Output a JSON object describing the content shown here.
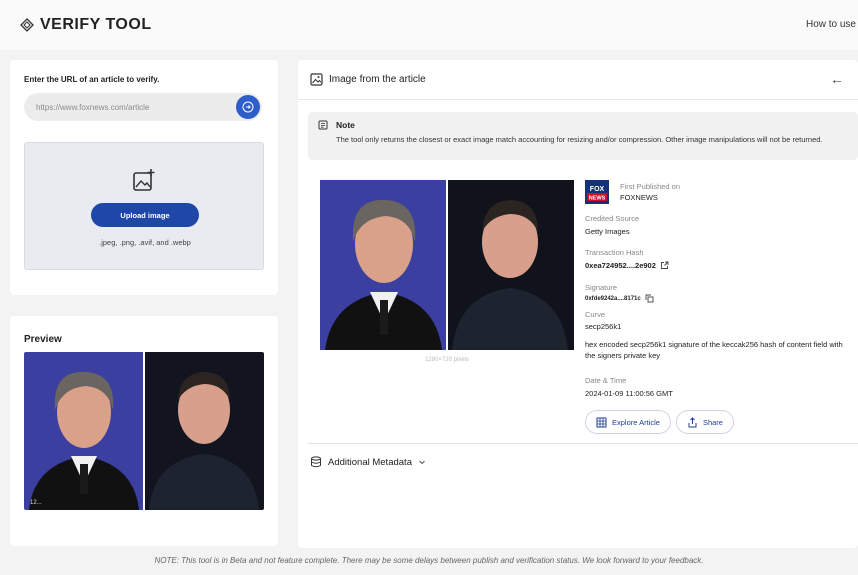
{
  "header": {
    "title": "VERIFY TOOL",
    "how_to_use": "How to use"
  },
  "url_form": {
    "label": "Enter the URL of an article to verify.",
    "placeholder": "https://www.foxnews.com/article"
  },
  "upload": {
    "button_label": "Upload image",
    "formats": ".jpeg, .png, .avif, and .webp"
  },
  "preview": {
    "title": "Preview",
    "caption": "12..."
  },
  "panel": {
    "title": "Image from the article",
    "note_title": "Note",
    "note_text": "The tool only returns the closest or exact image match accounting for resizing and/or compression. Other image manipulations will not be returned.",
    "image_caption": "1280×720 pixels"
  },
  "metadata": {
    "publisher_logo": "FOX NEWS",
    "first_published_label": "First Published on",
    "first_published_value": "FOXNEWS",
    "credited_source_label": "Credited Source",
    "credited_source_value": "Getty Images",
    "tx_hash_label": "Transaction Hash",
    "tx_hash_value": "0xea724952....2e902",
    "signature_label": "Signature",
    "signature_value": "0xfde9242a....8171c",
    "curve_label": "Curve",
    "curve_value": "secp256k1",
    "curve_desc": "hex encoded secp256k1 signature of the keccak256 hash of content field with the signers private key",
    "datetime_label": "Date & Time",
    "datetime_value": "2024-01-09 11:00:56 GMT",
    "explore_label": "Explore Article",
    "share_label": "Share"
  },
  "additional": {
    "label": "Additional Metadata"
  },
  "footer": {
    "note": "NOTE: This tool is in Beta and not feature complete. There may be some delays between publish and verification status. We look forward to your feedback."
  },
  "colors": {
    "accent": "#2e5fc9",
    "button": "#1f47a8",
    "photo_bg": "#3a3f9e"
  },
  "icons": [
    "diamond-logo-icon",
    "arrow-right-icon",
    "add-image-icon",
    "image-icon",
    "back-arrow-icon",
    "note-icon",
    "external-link-icon",
    "copy-icon",
    "grid-icon",
    "share-icon",
    "database-icon",
    "chevron-down-icon"
  ]
}
